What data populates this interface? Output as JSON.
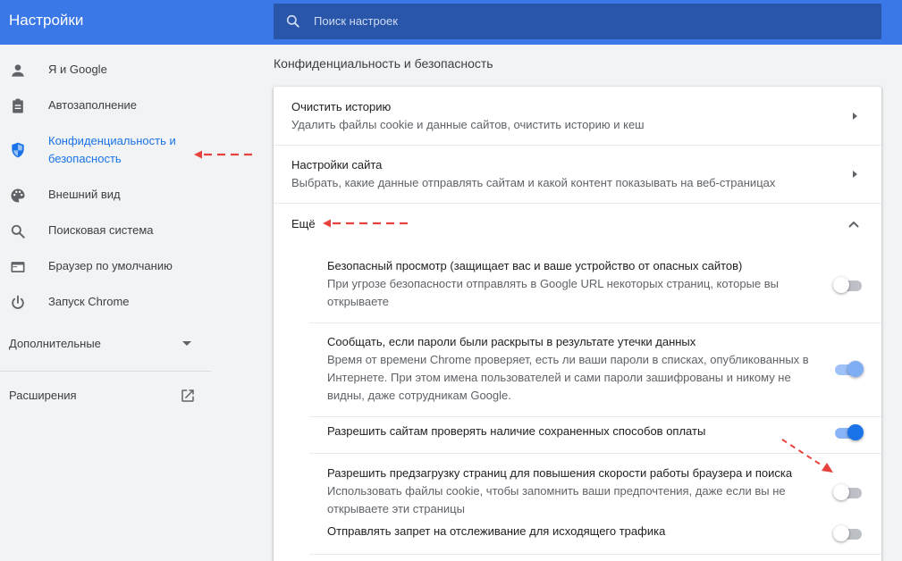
{
  "header": {
    "title": "Настройки",
    "search_placeholder": "Поиск настроек"
  },
  "sidebar": {
    "items": [
      {
        "label": "Я и Google",
        "icon": "person-icon"
      },
      {
        "label": "Автозаполнение",
        "icon": "clipboard-icon"
      },
      {
        "label_line1": "Конфиденциальность и",
        "label_line2": "безопасность",
        "icon": "shield-icon",
        "active": true
      },
      {
        "label": "Внешний вид",
        "icon": "palette-icon"
      },
      {
        "label": "Поисковая система",
        "icon": "search-icon"
      },
      {
        "label": "Браузер по умолчанию",
        "icon": "browser-icon"
      },
      {
        "label": "Запуск Chrome",
        "icon": "power-icon"
      }
    ],
    "advanced_label": "Дополнительные",
    "extensions_label": "Расширения"
  },
  "main": {
    "section_title": "Конфиденциальность и безопасность",
    "rows": [
      {
        "title": "Очистить историю",
        "subtitle": "Удалить файлы cookie и данные сайтов, очистить историю и кеш"
      },
      {
        "title": "Настройки сайта",
        "subtitle": "Выбрать, какие данные отправлять сайтам и какой контент показывать на веб-страницах"
      }
    ],
    "more_label": "Ещё",
    "toggles": [
      {
        "title": "Безопасный просмотр (защищает вас и ваше устройство от опасных сайтов)",
        "desc_line1": "При угрозе безопасности отправлять в Google URL некоторых страниц, которые вы",
        "desc_line2": "открываете",
        "state": "off"
      },
      {
        "title": "Сообщать, если пароли были раскрыты в результате утечки данных",
        "desc_line1": "Время от времени Chrome проверяет, есть ли ваши пароли в списках, опубликованных в",
        "desc_line2": "Интернете. При этом имена пользователей и сами пароли зашифрованы и никому не",
        "desc_line3": "видны, даже сотрудникам Google.",
        "state": "on-disabled"
      },
      {
        "title": "Разрешить сайтам проверять наличие сохраненных способов оплаты",
        "state": "on"
      },
      {
        "title": "Разрешить предзагрузку страниц для повышения скорости работы браузера и поиска",
        "desc_line1": "Использовать файлы cookie, чтобы запомнить ваши предпочтения, даже если вы не",
        "desc_line2": "открываете эти страницы",
        "state": "off"
      },
      {
        "title": "Отправлять запрет на отслеживание для исходящего трафика",
        "state": "off"
      }
    ]
  },
  "colors": {
    "header_bg": "#3b78e7",
    "search_bg": "#2956a9",
    "accent": "#1a73e8",
    "annotation_arrow": "#e8423f"
  }
}
